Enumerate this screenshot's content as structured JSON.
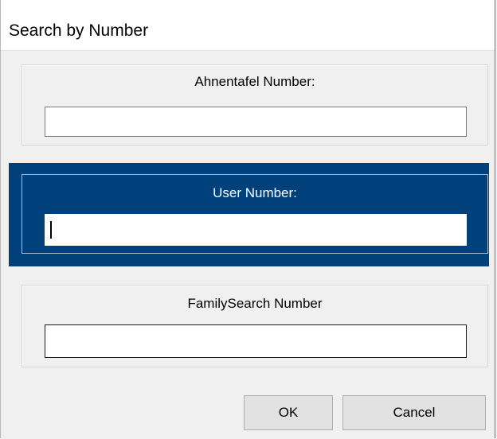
{
  "dialog": {
    "title": "Search by Number"
  },
  "sections": {
    "ahnentafel": {
      "label": "Ahnentafel Number:",
      "value": ""
    },
    "user": {
      "label": "User Number:",
      "value": ""
    },
    "familysearch": {
      "label": "FamilySearch Number",
      "value": ""
    }
  },
  "buttons": {
    "ok": "OK",
    "cancel": "Cancel"
  },
  "colors": {
    "selected_background": "#00417c",
    "dialog_background": "#f0f0f0",
    "button_background": "#e1e1e1"
  }
}
